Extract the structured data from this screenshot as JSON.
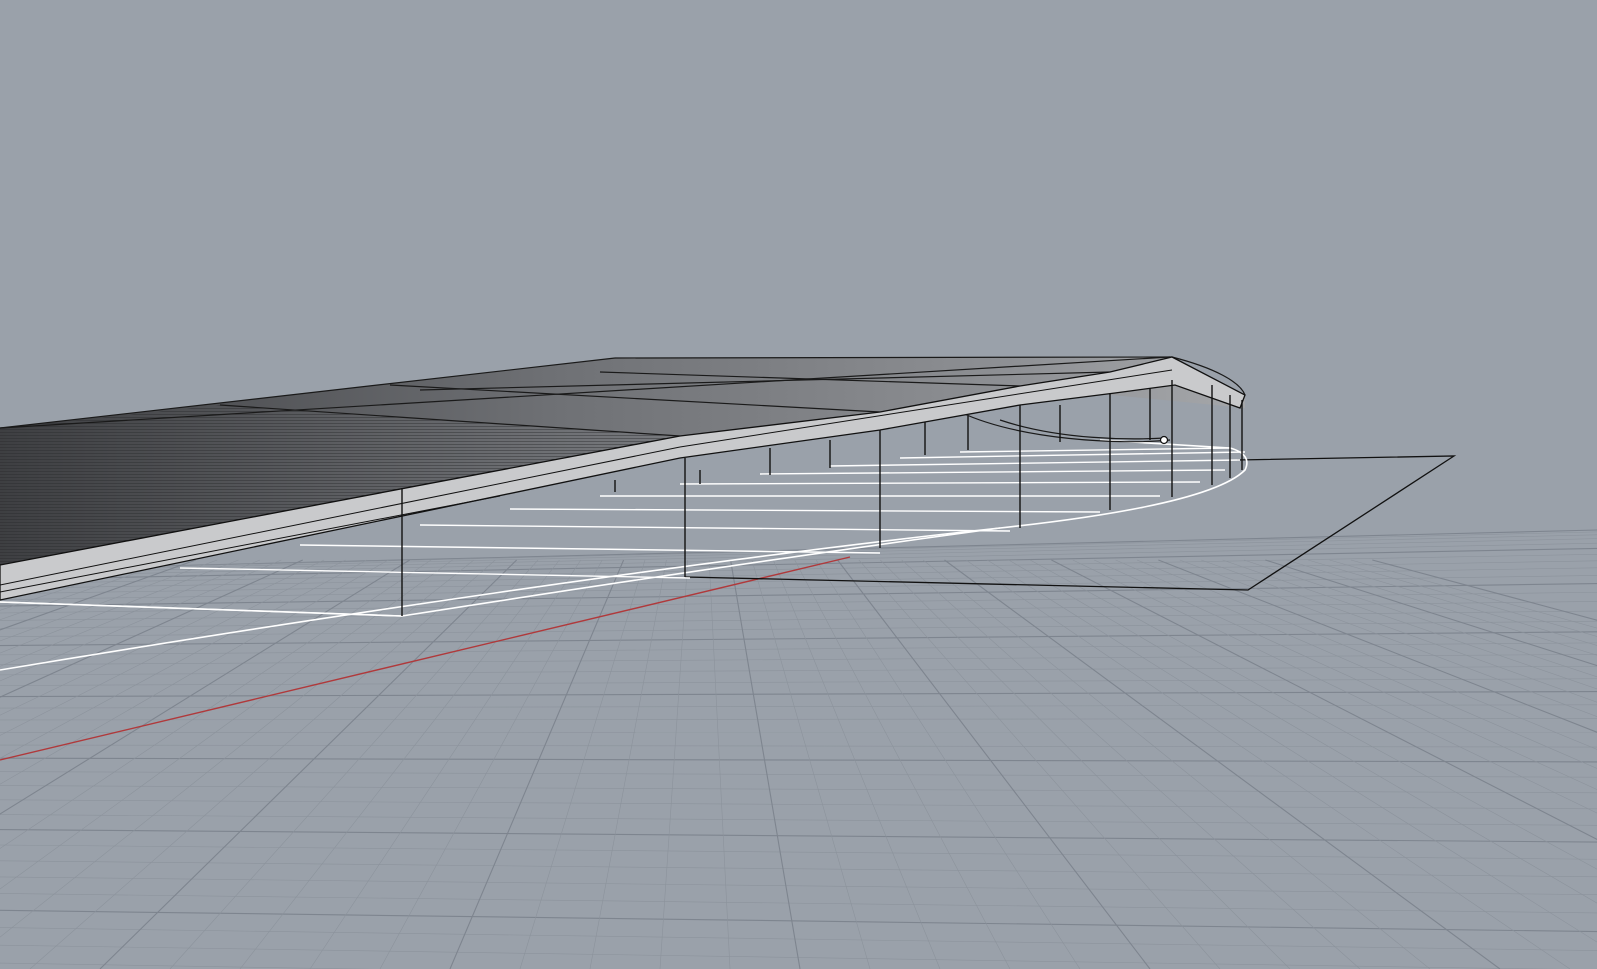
{
  "app": {
    "view": "perspective-viewport",
    "background_color": "#9aa1aa"
  },
  "scene": {
    "grid": {
      "visible": true,
      "minor_color": "#8c939c",
      "major_color": "#7e858f"
    },
    "axes": {
      "x_axis_color": "#b0393b"
    },
    "objects": [
      {
        "name": "canopy-roof",
        "color": "#8a8c90"
      },
      {
        "name": "roof-edge-band",
        "color": "#c9cacc"
      },
      {
        "name": "support-columns",
        "color": "#000000"
      },
      {
        "name": "ground-footprint-curve",
        "color": "#ffffff"
      },
      {
        "name": "boundary-rectangle",
        "color": "#000000"
      }
    ]
  }
}
